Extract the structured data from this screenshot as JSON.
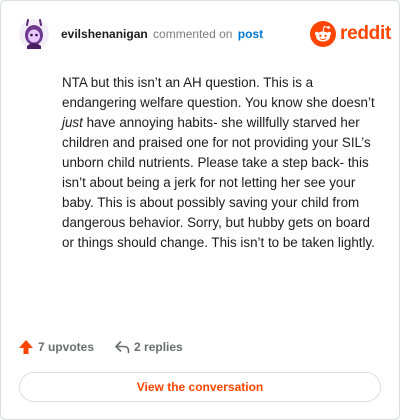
{
  "header": {
    "username": "evilshenanigan",
    "commented_text": "commented on",
    "post_link": "post",
    "logo_text": "reddit"
  },
  "comment": {
    "part1": "NTA but this isn’t an AH question. This is a endangering welfare question. You know she doesn’t ",
    "emphasis": "just",
    "part2": " have annoying habits- she willfully starved her children and praised one for not providing your SIL’s unborn child nutrients. Please take a step back- this isn’t about being a jerk for not letting her see your baby. This is about possibly saving your child from dangerous behavior. Sorry, but hubby gets on board or things should change. This isn’t to be taken lightly."
  },
  "actions": {
    "upvotes": "7 upvotes",
    "replies": "2 replies"
  },
  "cta": {
    "label": "View the conversation"
  },
  "colors": {
    "brand": "#ff4500",
    "link": "#0079d3",
    "text": "#1c1c1c",
    "muted": "#7c7c7c"
  },
  "icons": {
    "upvote": "upvote-arrow-icon",
    "reply": "reply-arrow-icon",
    "logo": "reddit-snoo-icon"
  }
}
